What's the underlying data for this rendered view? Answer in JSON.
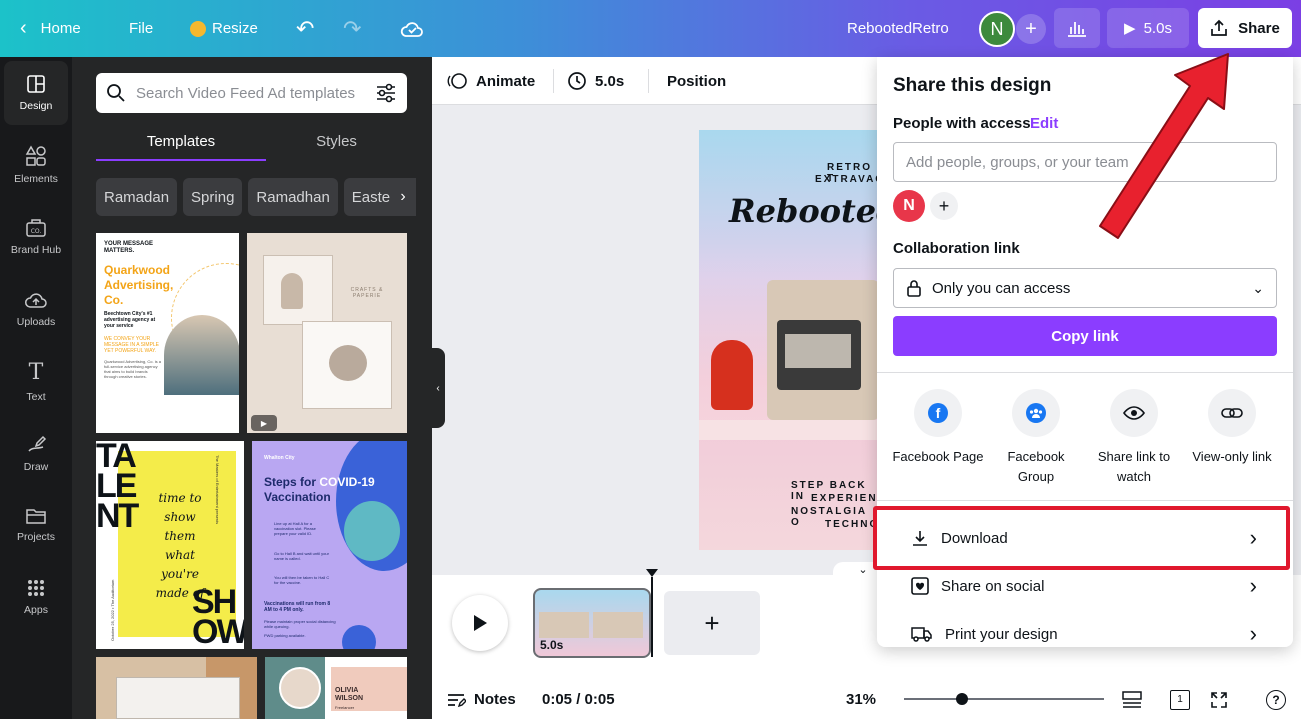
{
  "topbar": {
    "home": "Home",
    "file": "File",
    "resize": "Resize",
    "doc_title": "RebootedRetro",
    "avatar_initial": "N",
    "duration": "5.0s",
    "share": "Share"
  },
  "rail": [
    {
      "label": "Design",
      "icon": "design-icon"
    },
    {
      "label": "Elements",
      "icon": "elements-icon"
    },
    {
      "label": "Brand Hub",
      "icon": "brand-hub-icon"
    },
    {
      "label": "Uploads",
      "icon": "uploads-icon"
    },
    {
      "label": "Text",
      "icon": "text-icon"
    },
    {
      "label": "Draw",
      "icon": "draw-icon"
    },
    {
      "label": "Projects",
      "icon": "projects-icon"
    },
    {
      "label": "Apps",
      "icon": "apps-icon"
    }
  ],
  "panel": {
    "search_placeholder": "Search Video Feed Ad templates",
    "tabs": [
      "Templates",
      "Styles"
    ],
    "chips": [
      "Ramadan",
      "Spring",
      "Ramadhan",
      "Easter"
    ],
    "templates": {
      "t1": {
        "heading": "YOUR MESSAGE MATTERS.",
        "title": "Quarkwood Advertising, Co.",
        "sub": "Beechtown City's #1 advertising agency at your service",
        "tagline": "WE CONVEY YOUR MESSAGE IN A SIMPLE YET POWERFUL WAY.",
        "body": "Quarkwood Advertising, Co. is a full-service advertising agency that aims to build brands through creative stories."
      },
      "t2": {
        "brand": "CRAFTS & PAPERIE"
      },
      "t3": {
        "big_top": "TA LE NT",
        "script": "time to show them what you're made of",
        "big_bottom": "SH OW",
        "side_text": "The Masters of Entertainment presents",
        "date_text": "October 25, 2022 • The Auditorium"
      },
      "t4": {
        "city": "Whalton City",
        "title_a": "Steps for ",
        "title_b": "COVID-19",
        "title_c": " Vaccination",
        "step1": "Line up at Hall A for a vaccination slot. Please prepare your valid ID.",
        "step2": "Go to Hall B and wait until your name is called.",
        "step3": "You will then be taken to Hall C for the vaccine.",
        "hours": "Vaccinations will run from 8 AM to 4 PM only.",
        "note": "Please maintain proper social distancing while queuing.",
        "pwd": "PWD parking available."
      },
      "t6": {
        "name": "OLIVIA WILSON",
        "role": "Freelancer"
      }
    }
  },
  "toolbar": {
    "animate": "Animate",
    "duration": "5.0s",
    "position": "Position"
  },
  "canvas": {
    "line1": "RETRO T",
    "line2": "EXTRAVAG",
    "script_title": "Rebooted",
    "body1": "STEP BACK IN",
    "body2": "EXPERIEN",
    "body3": "NOSTALGIA O",
    "body4": "TECHNO"
  },
  "timeline": {
    "clip_time": "5.0s"
  },
  "bottom": {
    "notes": "Notes",
    "time": "0:05 / 0:05",
    "zoom": "31%",
    "page_num": "1"
  },
  "share": {
    "title": "Share this design",
    "people_label": "People with access",
    "edit": "Edit",
    "add_placeholder": "Add people, groups, or your team",
    "avatar": "N",
    "collab_label": "Collaboration link",
    "access_value": "Only you can access",
    "copy_link": "Copy link",
    "options": [
      {
        "label": "Facebook Page",
        "icon": "facebook-icon"
      },
      {
        "label": "Facebook Group",
        "icon": "facebook-group-icon"
      },
      {
        "label": "Share link to watch",
        "icon": "eye-icon"
      },
      {
        "label": "View-only link",
        "icon": "link-icon"
      }
    ],
    "rows": [
      "Download",
      "Share on social",
      "Print your design"
    ]
  },
  "colors": {
    "accent": "#8b3dff",
    "highlight": "#e0182d"
  }
}
